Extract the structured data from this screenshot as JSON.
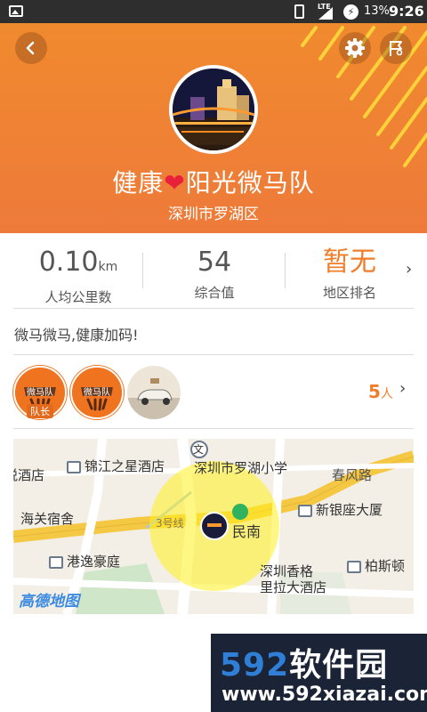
{
  "status_bar": {
    "network": "LTE",
    "battery_percent": "13%",
    "time": "9:26"
  },
  "header": {
    "team_name_before": "健康",
    "team_name_heart": "❤",
    "team_name_after": "阳光微马队",
    "location": "深圳市罗湖区",
    "accent_color": "#f08a2e",
    "stripe_color": "#ffd23a"
  },
  "stats": {
    "avg_km": {
      "value": "0.10",
      "unit": "km",
      "label": "人均公里数"
    },
    "score": {
      "value": "54",
      "label": "综合值"
    },
    "rank": {
      "value": "暂无",
      "label": "地区排名"
    }
  },
  "slogan": "微马微马,健康加码!",
  "members": {
    "captain_label": "队长",
    "badge_text": "微马队",
    "count_number": "5",
    "count_unit": "人"
  },
  "map": {
    "labels": {
      "l1": "锦江之星酒店",
      "l2": "深圳市罗湖小学",
      "l3": "春风路",
      "l4": "海关宿舍",
      "l5": "新银座大厦",
      "l6": "民南",
      "l7": "港逸豪庭",
      "l8": "深圳香格",
      "l9": "里拉大酒店",
      "l10": "柏斯顿",
      "l11": "悦酒店",
      "l12": "3号线",
      "l13": "文"
    },
    "brand": "高德地图"
  },
  "watermark": {
    "big_digits": "592",
    "big_text": "软件园",
    "url": "www.592xiazai.com"
  }
}
